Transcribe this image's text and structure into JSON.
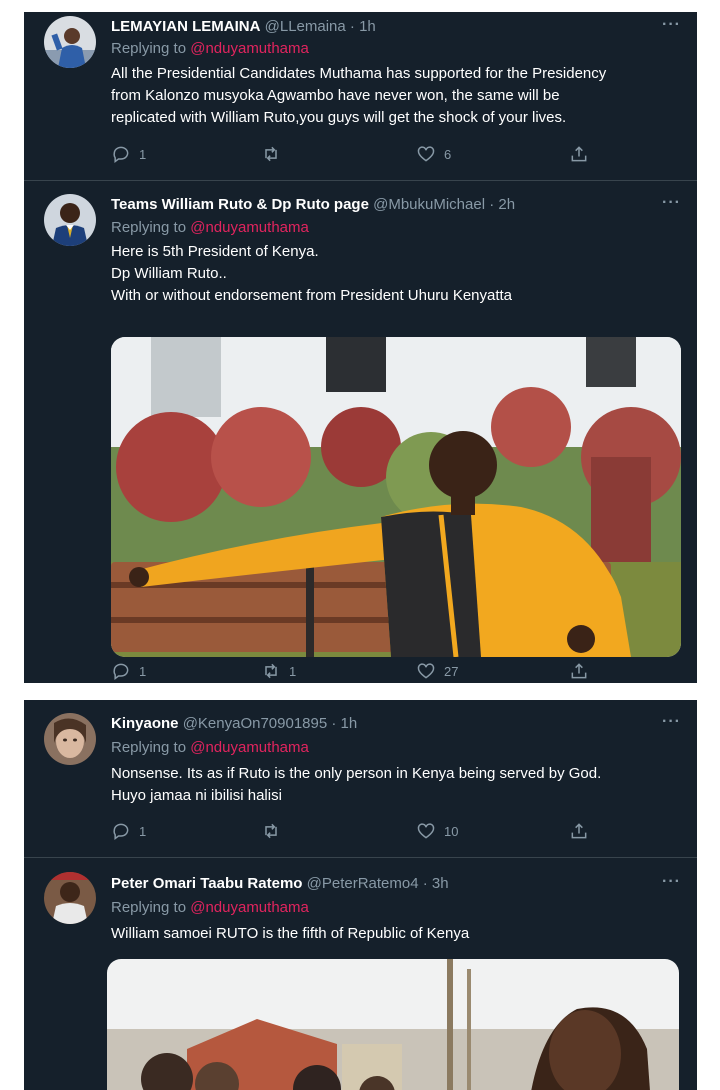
{
  "reply_prefix": "Replying to",
  "more_label": "···",
  "panels": [
    {
      "tweets": [
        {
          "name": "LEMAYIAN LEMAINA",
          "handle": "@LLemaina",
          "dot": "·",
          "time": "1h",
          "replying_to": "@nduyamuthama",
          "lines": [
            "All the Presidential Candidates Muthama has supported for the Presidency",
            "from  Kalonzo musyoka Agwambo  have never won, the same will be",
            "replicated with William Ruto,you guys will get the shock of your lives."
          ],
          "replies": "1",
          "retweets": "",
          "likes": "6"
        },
        {
          "name": "Teams William Ruto & Dp Ruto page",
          "handle": "@MbukuMichael",
          "dot": "·",
          "time": "2h",
          "replying_to": "@nduyamuthama",
          "lines": [
            "Here is 5th President of Kenya.",
            "Dp William Ruto..",
            "With or without endorsement from President Uhuru Kenyatta"
          ],
          "replies": "1",
          "retweets": "1",
          "likes": "27"
        }
      ]
    },
    {
      "tweets": [
        {
          "name": "Kinyaone",
          "handle": "@KenyaOn70901895",
          "dot": "·",
          "time": "1h",
          "replying_to": "@nduyamuthama",
          "lines": [
            "Nonsense. Its as if Ruto is the only person in Kenya being served by God.",
            "Huyo jamaa ni ibilisi halisi"
          ],
          "replies": "1",
          "retweets": "",
          "likes": "10"
        },
        {
          "name": "Peter Omari Taabu Ratemo",
          "handle": "@PeterRatemo4",
          "dot": "·",
          "time": "3h",
          "replying_to": "@nduyamuthama",
          "lines": [
            "William samoei RUTO is the fifth of Republic of Kenya"
          ]
        }
      ]
    }
  ],
  "colors": {
    "background": "#15202b",
    "text": "#ffffff",
    "muted": "#8899a6",
    "mention": "#e0245e",
    "divider": "#38444d"
  },
  "icons": [
    "reply-icon",
    "retweet-icon",
    "like-icon",
    "share-icon",
    "more-icon"
  ]
}
